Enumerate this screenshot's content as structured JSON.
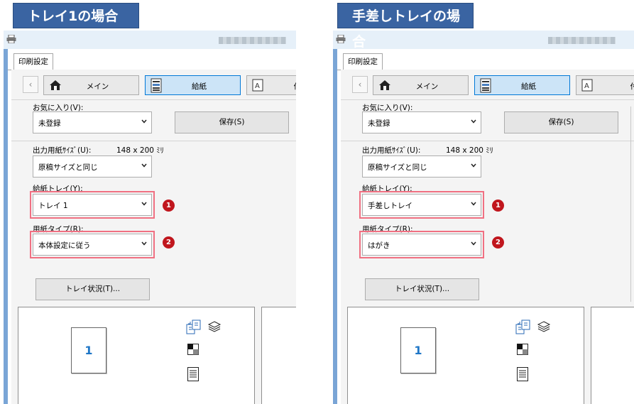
{
  "panels": [
    {
      "heading": "トレイ1の場合",
      "tab_label": "印刷設定",
      "nav": {
        "back": "‹",
        "main": "メイン",
        "paper": "給紙",
        "next": "付"
      },
      "favorites_label": "お気に入り(V):",
      "favorites_value": "未登録",
      "save_label": "保存(S)",
      "output_size_label": "出力用紙ｻｲｽﾞ(U):",
      "output_size_dims": "148 x 200 ﾐﾘ",
      "output_size_value": "原稿サイズと同じ",
      "tray_label": "給紙トレイ(Y):",
      "tray_value": "トレイ 1",
      "paper_type_label": "用紙タイプ(R):",
      "paper_type_value": "本体設定に従う",
      "tray_status_label": "トレイ状況(T)...",
      "marker_1": "1",
      "marker_2": "2",
      "preview_page_number": "1"
    },
    {
      "heading": "手差しトレイの場合",
      "tab_label": "印刷設定",
      "nav": {
        "back": "‹",
        "main": "メイン",
        "paper": "給紙",
        "next": "付"
      },
      "favorites_label": "お気に入り(V):",
      "favorites_value": "未登録",
      "save_label": "保存(S)",
      "output_size_label": "出力用紙ｻｲｽﾞ(U):",
      "output_size_dims": "148 x 200 ﾐﾘ",
      "output_size_value": "原稿サイズと同じ",
      "tray_label": "給紙トレイ(Y):",
      "tray_value": "手差しトレイ",
      "paper_type_label": "用紙タイプ(R):",
      "paper_type_value": "はがき",
      "tray_status_label": "トレイ状況(T)...",
      "marker_1": "1",
      "marker_2": "2",
      "preview_page_number": "1"
    }
  ],
  "colors": {
    "heading_bg": "#3a64a2",
    "highlight": "#f07082",
    "marker": "#c0161d",
    "window_frame": "#7aa5d6",
    "active_tab": "#cce4f7"
  }
}
